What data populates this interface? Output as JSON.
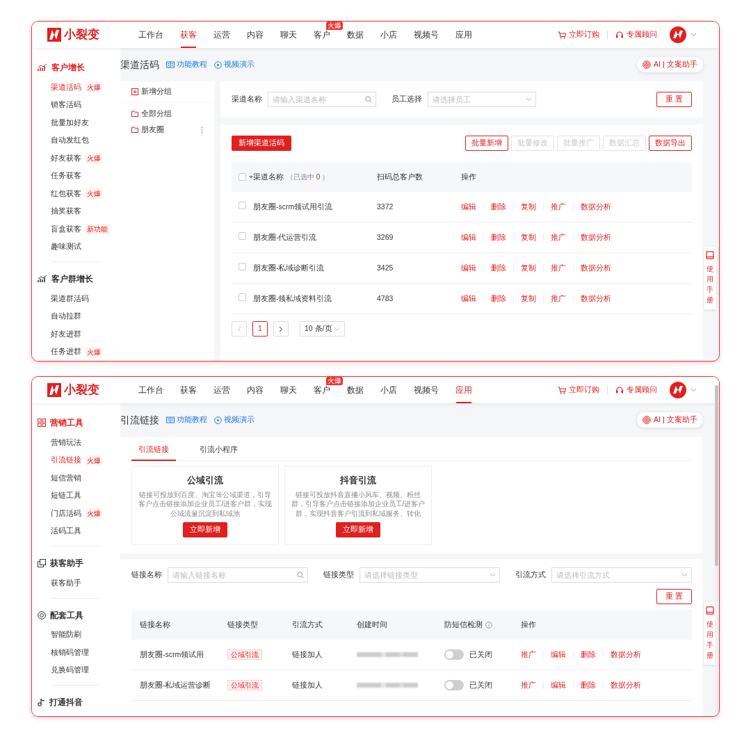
{
  "screens": [
    {
      "kind": "channel_codes",
      "header": {
        "brand": "小裂变",
        "nav": [
          {
            "label": "工作台",
            "selected": false
          },
          {
            "label": "获客",
            "selected": true
          },
          {
            "label": "运营",
            "selected": false
          },
          {
            "label": "内容",
            "selected": false
          },
          {
            "label": "聊天",
            "selected": false
          },
          {
            "label": "客户",
            "selected": false,
            "badge": "火爆"
          },
          {
            "label": "数据",
            "selected": false
          },
          {
            "label": "小店",
            "selected": false
          },
          {
            "label": "视频号",
            "selected": false
          },
          {
            "label": "应用",
            "selected": false
          }
        ],
        "order": "立即订购",
        "consultant": "专属顾问"
      },
      "sidebar": [
        {
          "title": "客户增长",
          "kind": "chart",
          "selected": true,
          "items": [
            {
              "label": "渠道活码",
              "selected": true,
              "tag": "火爆"
            },
            {
              "label": "锁客活码",
              "selected": false
            },
            {
              "label": "批量加好友",
              "selected": false
            },
            {
              "label": "自动发红包",
              "selected": false
            },
            {
              "label": "好友获客",
              "selected": false,
              "tag": "火爆"
            },
            {
              "label": "任务获客",
              "selected": false
            },
            {
              "label": "红包获客",
              "selected": false,
              "tag": "火爆"
            },
            {
              "label": "抽奖获客",
              "selected": false
            },
            {
              "label": "盲盒获客",
              "selected": false,
              "tag": "新功能"
            },
            {
              "label": "趣味测试",
              "selected": false
            }
          ]
        },
        {
          "title": "客户群增长",
          "kind": "chart",
          "selected": false,
          "items": [
            {
              "label": "渠道群活码",
              "selected": false
            },
            {
              "label": "自动拉群",
              "selected": false
            },
            {
              "label": "好友进群",
              "selected": false
            },
            {
              "label": "任务进群",
              "selected": false,
              "tag": "火爆"
            }
          ]
        }
      ],
      "page": {
        "title": "渠道活码",
        "tutorial": "功能教程",
        "video": "视频演示",
        "ai": "AI",
        "ai_label": "文案助手"
      },
      "manual": "使用手册",
      "groups": {
        "add": "新增分组",
        "items": [
          {
            "label": "全部分组",
            "menu": false
          },
          {
            "label": "朋友圈",
            "menu": true
          }
        ]
      },
      "filters": [
        {
          "label": "渠道名称",
          "placeholder": "请输入渠道名称",
          "kind": "search"
        },
        {
          "label": "员工选择",
          "placeholder": "请选择员工",
          "kind": "select"
        }
      ],
      "reset": "重 置",
      "create": "新增渠道活码",
      "actions": [
        {
          "label": "批量新增",
          "disabled": false
        },
        {
          "label": "批量修改",
          "disabled": true
        },
        {
          "label": "批量推广",
          "disabled": true
        },
        {
          "label": "数据汇总",
          "disabled": true
        },
        {
          "label": "数据导出",
          "disabled": false
        }
      ],
      "table": {
        "select_all": false,
        "columns": [
          "渠道名称",
          "扫码总客户数",
          "操作"
        ],
        "selection": {
          "prefix": "（已选中",
          "count": "0",
          "suffix": "）"
        },
        "rows": [
          {
            "checked": false,
            "name": "朋友圈-scrm领试用引流",
            "scans": "3372",
            "actions": [
              "编辑",
              "删除",
              "复制",
              "推广",
              "数据分析"
            ]
          },
          {
            "checked": false,
            "name": "朋友圈-代运营引流",
            "scans": "3269",
            "actions": [
              "编辑",
              "删除",
              "复制",
              "推广",
              "数据分析"
            ]
          },
          {
            "checked": false,
            "name": "朋友圈-私域诊断引流",
            "scans": "3425",
            "actions": [
              "编辑",
              "删除",
              "复制",
              "推广",
              "数据分析"
            ]
          },
          {
            "checked": false,
            "name": "朋友圈-领私域资料引流",
            "scans": "4783",
            "actions": [
              "编辑",
              "删除",
              "复制",
              "推广",
              "数据分析"
            ]
          }
        ]
      },
      "pagination": {
        "pages": [
          {
            "label": "1",
            "selected": true
          }
        ],
        "page_size": "10 条/页"
      }
    },
    {
      "kind": "links",
      "scrollable": true,
      "header": {
        "brand": "小裂变",
        "nav": [
          {
            "label": "工作台",
            "selected": false
          },
          {
            "label": "获客",
            "selected": false
          },
          {
            "label": "运营",
            "selected": false
          },
          {
            "label": "内容",
            "selected": false
          },
          {
            "label": "聊天",
            "selected": false
          },
          {
            "label": "客户",
            "selected": false,
            "badge": "火爆"
          },
          {
            "label": "数据",
            "selected": false
          },
          {
            "label": "小店",
            "selected": false
          },
          {
            "label": "视频号",
            "selected": false
          },
          {
            "label": "应用",
            "selected": true
          }
        ],
        "order": "立即订购",
        "consultant": "专属顾问"
      },
      "sidebar": [
        {
          "title": "营销工具",
          "kind": "grid",
          "selected": true,
          "items": [
            {
              "label": "营销玩法",
              "selected": false
            },
            {
              "label": "引流链接",
              "selected": true,
              "tag": "火爆"
            },
            {
              "label": "短信营销",
              "selected": false
            },
            {
              "label": "短链工具",
              "selected": false
            },
            {
              "label": "门店活码",
              "selected": false,
              "tag": "火爆"
            },
            {
              "label": "活码工具",
              "selected": false
            }
          ]
        },
        {
          "title": "获客助手",
          "kind": "copy",
          "selected": false,
          "items": [
            {
              "label": "获客助手",
              "selected": false
            }
          ]
        },
        {
          "title": "配套工具",
          "kind": "target",
          "selected": false,
          "items": [
            {
              "label": "智能防刷",
              "selected": false
            },
            {
              "label": "核销码管理",
              "selected": false
            },
            {
              "label": "兑换码管理",
              "selected": false
            }
          ]
        },
        {
          "title": "打通抖音",
          "kind": "note",
          "selected": false
        }
      ],
      "page": {
        "title": "引流链接",
        "tutorial": "功能教程",
        "video": "视频演示",
        "ai": "AI",
        "ai_label": "文案助手"
      },
      "manual": "使用手册",
      "tabs": [
        {
          "label": "引流链接",
          "selected": true
        },
        {
          "label": "引流小程序",
          "selected": false
        }
      ],
      "cards": [
        {
          "title": "公域引流",
          "description": "链接可投放到百度、淘宝等公域渠道，引导客户点击链接添加企业员工/进客户群，实现公域流量沉淀到私域池",
          "button": "立即新增"
        },
        {
          "title": "抖音引流",
          "description": "链接可投放抖音直播小风车、视频、粉丝群，引导客户点击链接添加企业员工/进客户群，实现抖音客户引流到私域服务、转化",
          "button": "立即新增"
        }
      ],
      "filters": [
        {
          "label": "链接名称",
          "placeholder": "请输入链接名称",
          "kind": "search"
        },
        {
          "label": "链接类型",
          "placeholder": "请选择链接类型",
          "kind": "select"
        },
        {
          "label": "引流方式",
          "placeholder": "请选择引流方式",
          "kind": "select"
        }
      ],
      "reset": "重 置",
      "table": {
        "columns": [
          {
            "label": "链接名称"
          },
          {
            "label": "链接类型"
          },
          {
            "label": "引流方式"
          },
          {
            "label": "创建时间"
          },
          {
            "label": "防短信检测",
            "info": true
          },
          {
            "label": "操作"
          }
        ],
        "rows": [
          {
            "name": "朋友圈-scrm领试用",
            "type": "公域引流",
            "method": "链接加人",
            "protect_on": false,
            "protect_status": "已关闭",
            "actions": [
              "推广",
              "编辑",
              "删除",
              "数据分析"
            ]
          },
          {
            "name": "朋友圈-私域运营诊断",
            "type": "公域引流",
            "method": "链接加人",
            "protect_on": false,
            "protect_status": "已关闭",
            "actions": [
              "推广",
              "编辑",
              "删除",
              "数据分析"
            ]
          }
        ]
      }
    }
  ]
}
